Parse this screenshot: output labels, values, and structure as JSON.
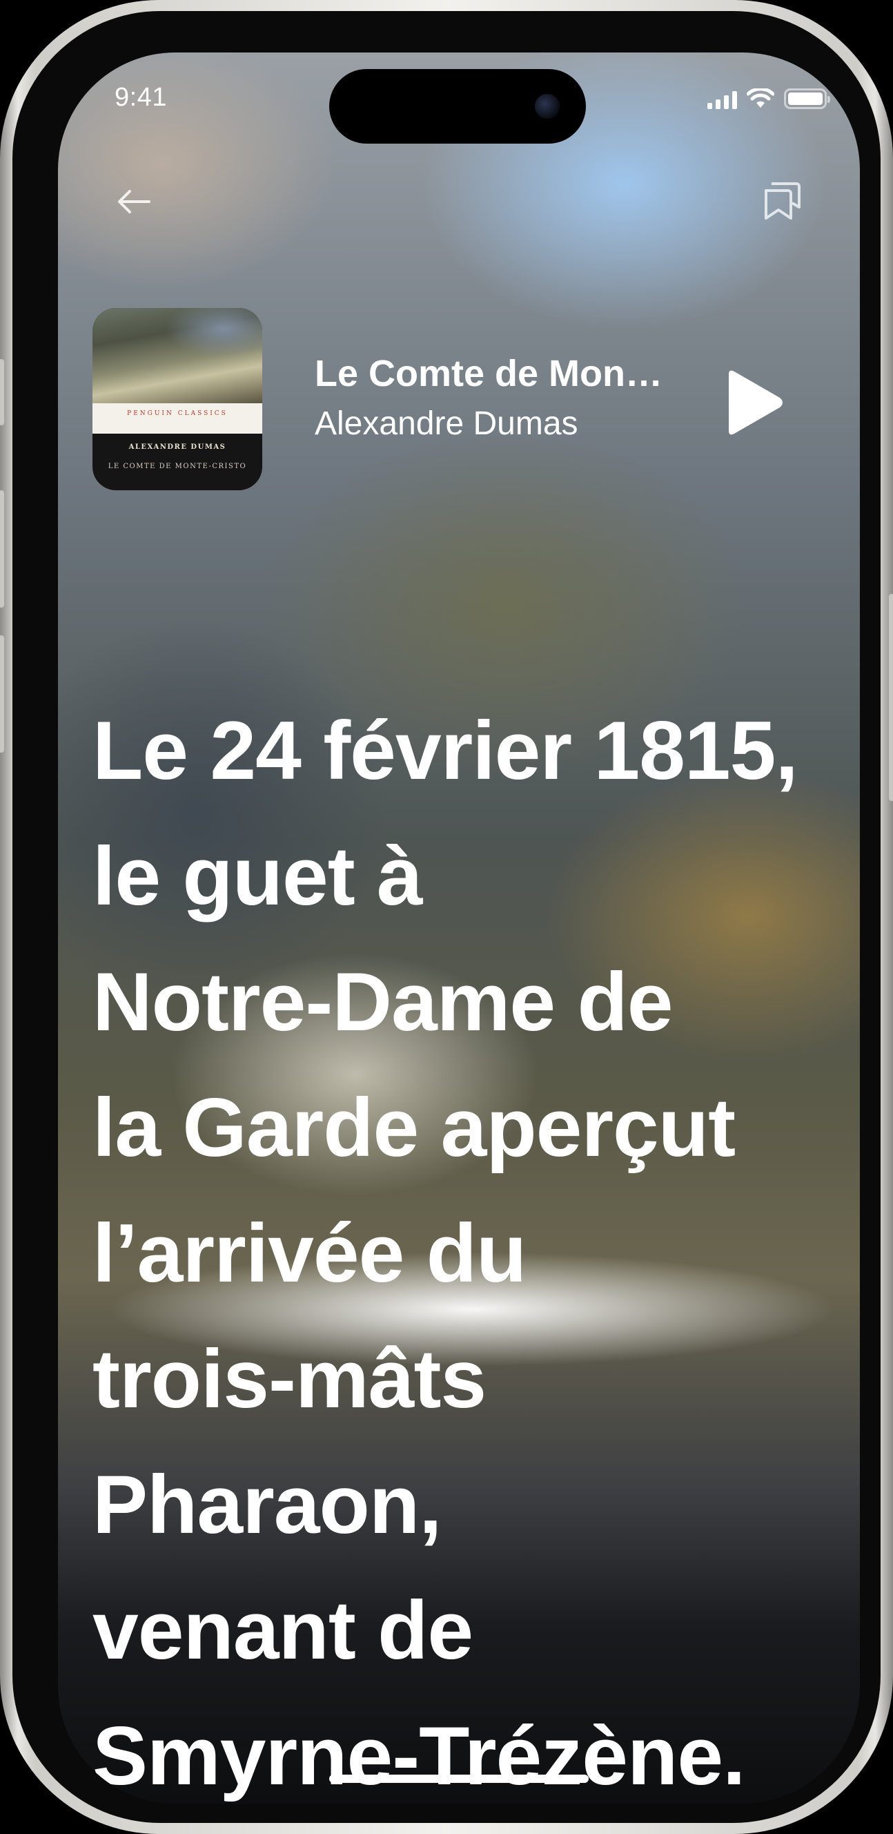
{
  "status_bar": {
    "time": "9:41"
  },
  "nav": {
    "back_icon": "arrow-left-icon",
    "chapters_icon": "chapters-icon"
  },
  "now_playing": {
    "title": "Le Comte de Mon…",
    "author": "Alexandre Dumas",
    "play_icon": "play-icon",
    "cover": {
      "series": "PENGUIN CLASSICS",
      "author": "ALEXANDRE DUMAS",
      "title": "LE COMTE DE MONTE-CRISTO"
    }
  },
  "reading": {
    "lines": [
      "Le 24 février 1815,",
      "le guet à",
      "Notre-Dame de",
      "la Garde aperçut",
      "l’arrivée du",
      "trois-mâts",
      "Pharaon,",
      "venant de",
      "Smyrne-Trézène."
    ]
  },
  "colors": {
    "text": "#ffffff",
    "frame": "#e9e7e2"
  }
}
